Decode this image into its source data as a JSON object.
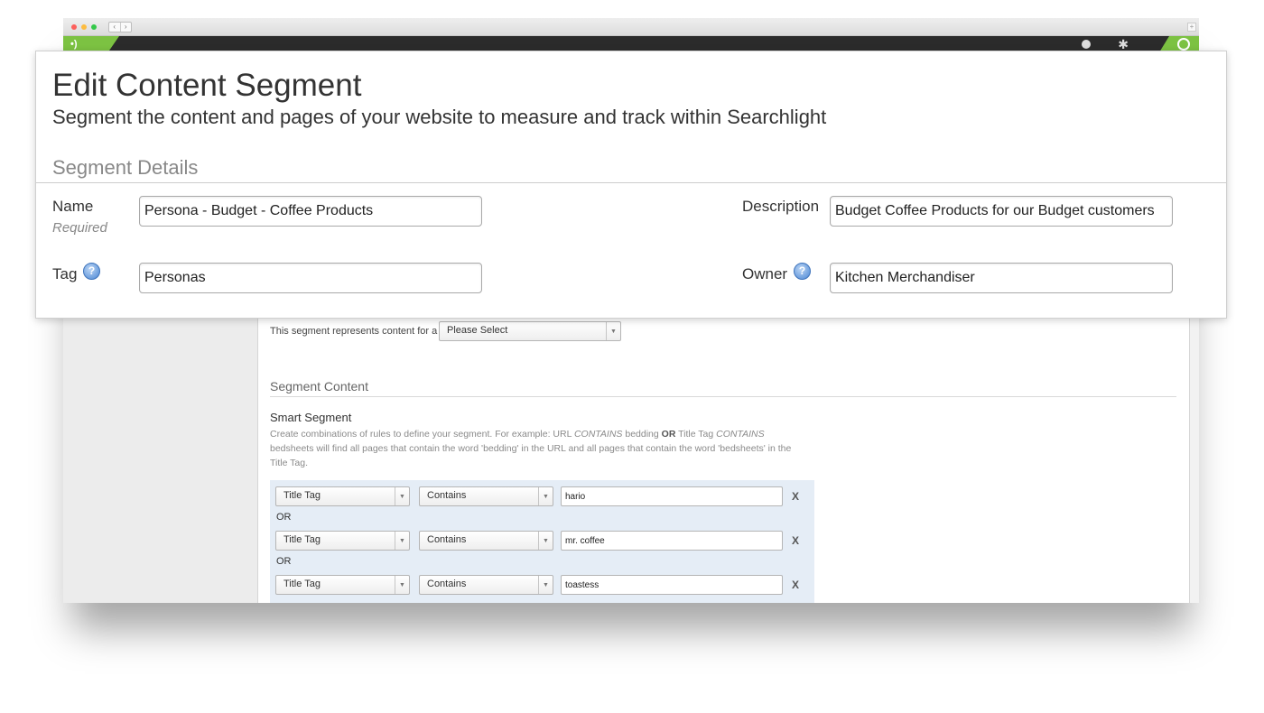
{
  "browser": {
    "nav_back": "‹",
    "nav_forward": "›",
    "new_tab": "+"
  },
  "app": {
    "logo_mark": "•)"
  },
  "edit_card": {
    "title": "Edit Content Segment",
    "subtitle": "Segment the content and pages of your website to measure and track within Searchlight",
    "section": "Segment Details",
    "name_label": "Name",
    "name_required": "Required",
    "name_value": "Persona - Budget - Coffee Products",
    "description_label": "Description",
    "description_value": "Budget Coffee Products for our Budget customers",
    "tag_label": "Tag",
    "tag_value": "Personas",
    "owner_label": "Owner",
    "owner_value": "Kitchen Merchandiser",
    "help_glyph": "?"
  },
  "background_form": {
    "represents_label": "This segment represents content for a",
    "represents_select": "Please Select",
    "segment_content_title": "Segment Content",
    "smart_segment_title": "Smart Segment",
    "smart_segment_desc_1": "Create combinations of rules to define your segment. For example: URL ",
    "smart_segment_desc_contains1": "CONTAINS",
    "smart_segment_desc_2": " bedding ",
    "smart_segment_desc_or": "OR",
    "smart_segment_desc_3": " Title Tag ",
    "smart_segment_desc_contains2": "CONTAINS",
    "smart_segment_desc_4": "bedsheets will find all pages that contain the word 'bedding' in the URL and all pages that contain the word 'bedsheets' in the",
    "smart_segment_desc_5": "Title Tag.",
    "remove_label": "X",
    "or_label": "OR",
    "rules": [
      {
        "field": "Title Tag",
        "operator": "Contains",
        "value": "hario"
      },
      {
        "field": "Title Tag",
        "operator": "Contains",
        "value": "mr. coffee"
      },
      {
        "field": "Title Tag",
        "operator": "Contains",
        "value": "toastess"
      }
    ]
  }
}
